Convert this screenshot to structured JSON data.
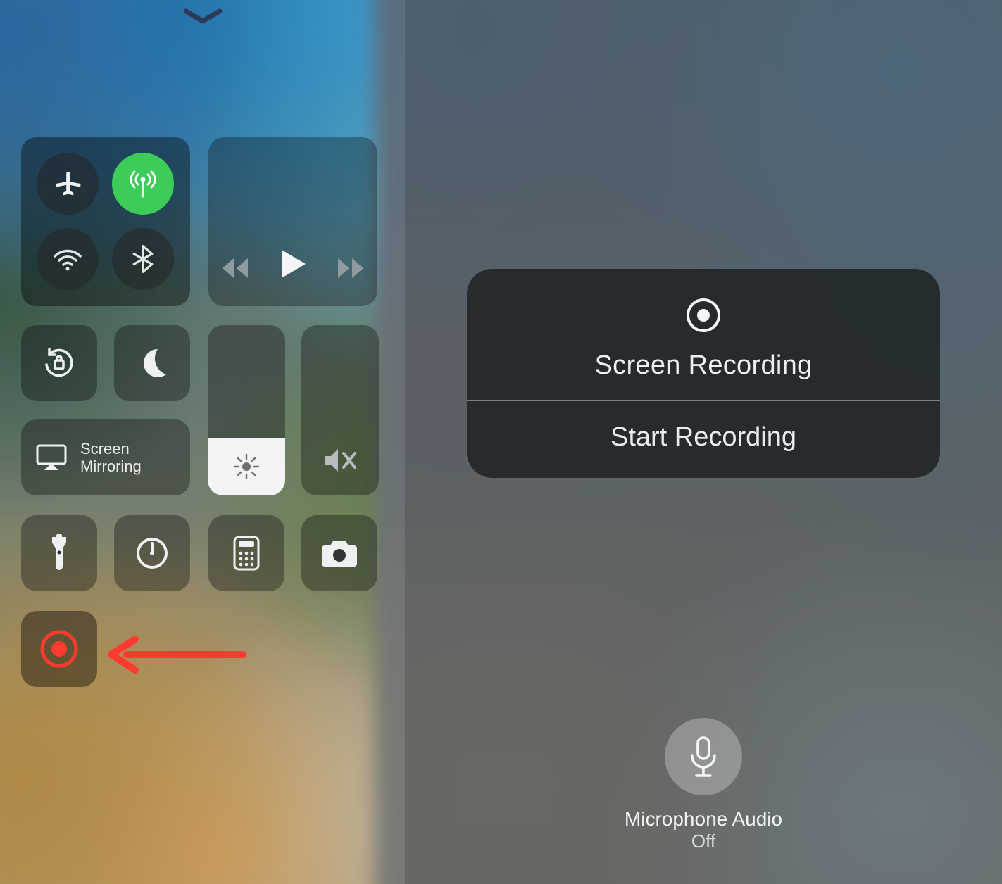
{
  "colors": {
    "accent_green": "#3dcb5a",
    "record_red": "#ff3b30"
  },
  "left": {
    "screen_mirroring_label": "Screen\nMirroring"
  },
  "right": {
    "card_title": "Screen Recording",
    "start_label": "Start Recording",
    "mic_label": "Microphone Audio",
    "mic_state": "Off"
  }
}
